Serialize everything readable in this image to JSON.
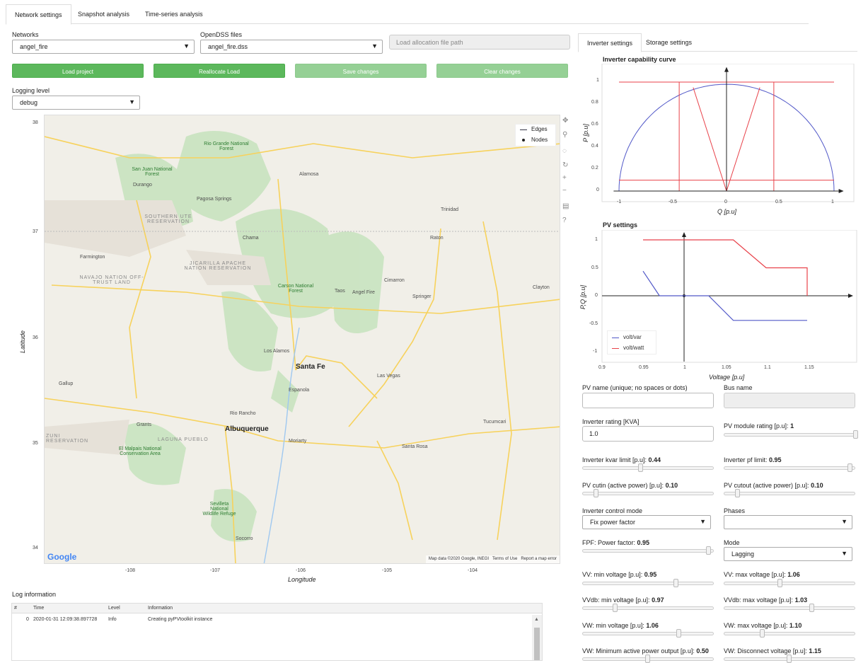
{
  "tabs": [
    "Network settings",
    "Snapshot analysis",
    "Time-series analysis"
  ],
  "networks": {
    "label": "Networks",
    "value": "angel_fire"
  },
  "opendss": {
    "label": "OpenDSS files",
    "value": "angel_fire.dss"
  },
  "load_alloc": {
    "placeholder": "Load allocation file path"
  },
  "buttons": {
    "load": "Load project",
    "realloc": "Reallocate Load",
    "save": "Save changes",
    "clear": "Clear changes"
  },
  "logging": {
    "label": "Logging level",
    "value": "debug"
  },
  "map": {
    "xlabel": "Longitude",
    "ylabel": "Latitude",
    "xticks": [
      "-108",
      "-107",
      "-106",
      "-105",
      "-104"
    ],
    "yticks": [
      "38",
      "37",
      "36",
      "35",
      "34"
    ],
    "legend": [
      "Edges",
      "Nodes"
    ],
    "attribution": [
      "Map data ©2020 Google, INEGI",
      "Terms of Use",
      "Report a map error"
    ],
    "google": "Google",
    "places": [
      {
        "t": "Durango",
        "c": ""
      },
      {
        "t": "Alamosa",
        "c": ""
      },
      {
        "t": "Taos",
        "c": ""
      },
      {
        "t": "Santa Fe",
        "c": "big"
      },
      {
        "t": "Albuquerque",
        "c": "big"
      },
      {
        "t": "Rio Rancho",
        "c": ""
      },
      {
        "t": "Farmington",
        "c": ""
      },
      {
        "t": "Los Alamos",
        "c": ""
      },
      {
        "t": "Las Vegas",
        "c": ""
      },
      {
        "t": "Raton",
        "c": ""
      },
      {
        "t": "Trinidad",
        "c": ""
      },
      {
        "t": "Gallup",
        "c": ""
      },
      {
        "t": "Grants",
        "c": ""
      },
      {
        "t": "Santa Rosa",
        "c": ""
      },
      {
        "t": "Tucumcari",
        "c": ""
      },
      {
        "t": "Socorro",
        "c": ""
      },
      {
        "t": "Moriarty",
        "c": ""
      },
      {
        "t": "Espanola",
        "c": ""
      },
      {
        "t": "Pagosa Springs",
        "c": ""
      },
      {
        "t": "Chama",
        "c": ""
      },
      {
        "t": "Cimarron",
        "c": ""
      },
      {
        "t": "Angel Fire",
        "c": ""
      },
      {
        "t": "Springer",
        "c": ""
      },
      {
        "t": "Clayton",
        "c": ""
      },
      {
        "t": "Rio Grande National Forest",
        "c": "green"
      },
      {
        "t": "San Juan National Forest",
        "c": "green"
      },
      {
        "t": "Carson National Forest",
        "c": "green"
      },
      {
        "t": "El Malpais National Conservation Area",
        "c": "green"
      },
      {
        "t": "Sevilleta National Wildlife Refuge",
        "c": "green"
      },
      {
        "t": "JICARILLA APACHE NATION RESERVATION",
        "c": "reg"
      },
      {
        "t": "NAVAJO NATION OFF-TRUST LAND",
        "c": "reg"
      },
      {
        "t": "SOUTHERN UTE RESERVATION",
        "c": "reg"
      },
      {
        "t": "LAGUNA PUEBLO",
        "c": "reg"
      },
      {
        "t": "ZUNI RESERVATION",
        "c": "reg"
      }
    ]
  },
  "log": {
    "title": "Log information",
    "cols": [
      "#",
      "Time",
      "Level",
      "Information"
    ],
    "rows": [
      {
        "n": "0",
        "time": "2020-01-31 12:09:38.897728",
        "level": "Info",
        "info": "Creating pyPVtoolkit instance"
      }
    ]
  },
  "right_tabs": [
    "Inverter settings",
    "Storage settings"
  ],
  "cap_chart": {
    "title": "Inverter capability curve",
    "xlabel": "Q [p.u]",
    "ylabel": "P [p.u]",
    "xticks": [
      "-1",
      "-0.5",
      "0",
      "0.5",
      "1"
    ],
    "yticks": [
      "0",
      "0.2",
      "0.4",
      "0.6",
      "0.8",
      "1"
    ]
  },
  "pv_chart": {
    "title": "PV settings",
    "xlabel": "Voltage [p.u]",
    "ylabel": "P,Q [p.u]",
    "xticks": [
      "0.9",
      "0.95",
      "1",
      "1.05",
      "1.1",
      "1.15"
    ],
    "yticks": [
      "-1",
      "-0.5",
      "0",
      "0.5",
      "1"
    ],
    "legend": [
      "volt/var",
      "volt/watt"
    ]
  },
  "chart_data": [
    {
      "type": "line",
      "title": "Inverter capability curve",
      "xlabel": "Q [p.u]",
      "ylabel": "P [p.u]",
      "xlim": [
        -1,
        1
      ],
      "ylim": [
        0,
        1
      ],
      "series": [
        {
          "values": [
            [
              -1,
              0
            ],
            [
              -0.7,
              0.7
            ],
            [
              0,
              0.98
            ],
            [
              0.7,
              0.7
            ],
            [
              1,
              0
            ]
          ]
        }
      ]
    },
    {
      "type": "line",
      "title": "PV settings",
      "xlabel": "Voltage [p.u]",
      "ylabel": "P,Q [p.u]",
      "xlim": [
        0.9,
        1.15
      ],
      "ylim": [
        -1,
        1
      ],
      "series": [
        {
          "name": "volt/var",
          "values": [
            [
              0.95,
              0.44
            ],
            [
              0.97,
              0
            ],
            [
              1.03,
              0
            ],
            [
              1.06,
              -0.44
            ],
            [
              1.15,
              -0.44
            ]
          ]
        },
        {
          "name": "volt/watt",
          "values": [
            [
              0.95,
              1
            ],
            [
              1.06,
              1
            ],
            [
              1.1,
              0.5
            ],
            [
              1.15,
              0.5
            ],
            [
              1.15,
              0
            ]
          ]
        }
      ]
    }
  ],
  "form": {
    "pv_name": "PV name (unique; no spaces or dots)",
    "bus_name": "Bus name",
    "inv_rating": "Inverter rating [KVA]",
    "inv_rating_value": "1.0",
    "pv_module": "PV module rating [p.u]:",
    "pv_module_val": "1",
    "kvar_limit": "Inverter kvar limit [p.u]:",
    "kvar_limit_val": "0.44",
    "pf_limit": "Inverter pf limit:",
    "pf_limit_val": "0.95",
    "cutin": "PV cutin (active power) [p.u]:",
    "cutin_val": "0.10",
    "cutout": "PV cutout (active power) [p.u]:",
    "cutout_val": "0.10",
    "ctrl_mode": "Inverter control mode",
    "ctrl_mode_val": "Fix power factor",
    "phases": "Phases",
    "phases_val": "",
    "fpf": "FPF: Power factor:",
    "fpf_val": "0.95",
    "mode": "Mode",
    "mode_val": "Lagging",
    "vv_min": "VV: min voltage [p.u]:",
    "vv_min_val": "0.95",
    "vv_max": "VV: max voltage [p.u]:",
    "vv_max_val": "1.06",
    "vvdb_min": "VVdb: min voltage [p.u]:",
    "vvdb_min_val": "0.97",
    "vvdb_max": "VVdb: max voltage [p.u]:",
    "vvdb_max_val": "1.03",
    "vw_min": "VW: min voltage [p.u]:",
    "vw_min_val": "1.06",
    "vw_max": "VW: max voltage [p.u]:",
    "vw_max_val": "1.10",
    "vw_minp": "VW: Minimum active power output [p.u]:",
    "vw_minp_val": "0.50",
    "vw_disc": "VW: Disconnect voltage [p.u]:",
    "vw_disc_val": "1.15"
  },
  "colors": {
    "green": "#5cb85c",
    "red": "#e8424a",
    "blue": "#5158c8"
  }
}
